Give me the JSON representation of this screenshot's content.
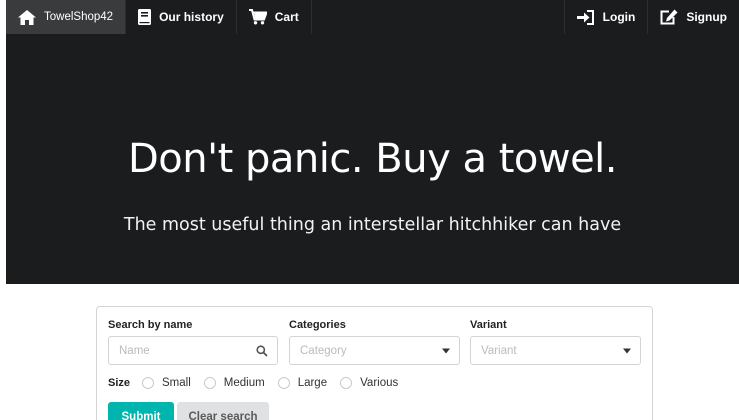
{
  "nav": {
    "brand": {
      "label": "TowelShop42",
      "icon": "home-icon"
    },
    "history": {
      "label": "Our history",
      "icon": "book-icon"
    },
    "cart": {
      "label": "Cart",
      "icon": "cart-icon"
    },
    "login": {
      "label": "Login",
      "icon": "sign-in-icon"
    },
    "signup": {
      "label": "Signup",
      "icon": "edit-icon"
    }
  },
  "hero": {
    "title": "Don't panic. Buy a towel.",
    "subtitle": "The most useful thing an interstellar hitchhiker can have"
  },
  "search": {
    "name_label": "Search by name",
    "name_placeholder": "Name",
    "categories_label": "Categories",
    "categories_placeholder": "Category",
    "variant_label": "Variant",
    "variant_placeholder": "Variant",
    "size_label": "Size",
    "sizes": [
      "Small",
      "Medium",
      "Large",
      "Various"
    ],
    "submit_label": "Submit",
    "clear_label": "Clear search"
  },
  "colors": {
    "navbar": "#1b1c1d",
    "accent": "#00b5ad",
    "secondary_button": "#e0e1e2"
  }
}
